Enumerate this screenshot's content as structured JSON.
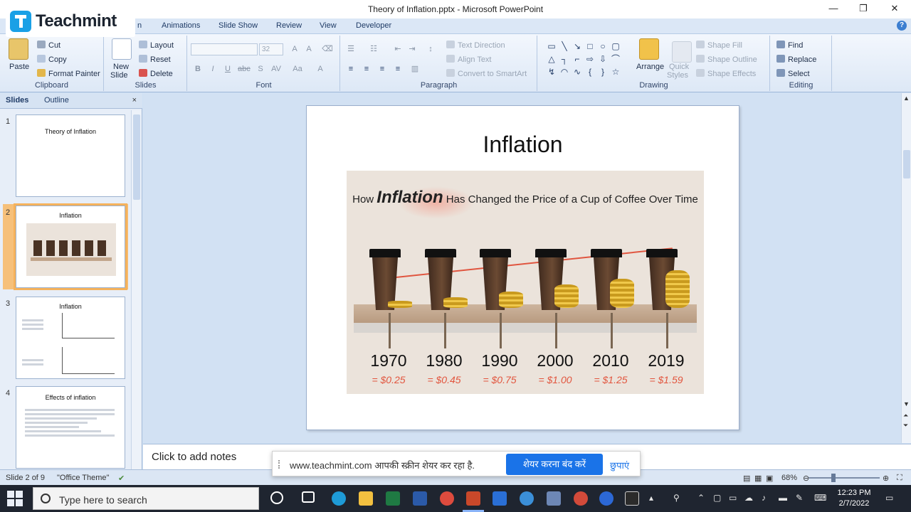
{
  "window": {
    "title": "Theory of Inflation.pptx - Microsoft PowerPoint",
    "minimize": "—",
    "restore": "❐",
    "close": "✕"
  },
  "overlay_logo": {
    "text": "Teachmint"
  },
  "tabs": [
    {
      "label": "n"
    },
    {
      "label": "Animations"
    },
    {
      "label": "Slide Show"
    },
    {
      "label": "Review"
    },
    {
      "label": "View"
    },
    {
      "label": "Developer"
    }
  ],
  "ribbon": {
    "clipboard": {
      "label": "Clipboard",
      "paste": "Paste",
      "cut": "Cut",
      "copy": "Copy",
      "format_painter": "Format Painter"
    },
    "slides": {
      "label": "Slides",
      "new_slide_1": "New",
      "new_slide_2": "Slide",
      "layout": "Layout",
      "reset": "Reset",
      "delete": "Delete"
    },
    "font": {
      "label": "Font",
      "size": "32"
    },
    "paragraph": {
      "label": "Paragraph",
      "text_direction": "Text Direction",
      "align_text": "Align Text",
      "convert_smartart": "Convert to SmartArt"
    },
    "drawing": {
      "label": "Drawing",
      "arrange": "Arrange",
      "quick_styles_1": "Quick",
      "quick_styles_2": "Styles",
      "shape_fill": "Shape Fill",
      "shape_outline": "Shape Outline",
      "shape_effects": "Shape Effects"
    },
    "editing": {
      "label": "Editing",
      "find": "Find",
      "replace": "Replace",
      "select": "Select"
    }
  },
  "left_pane": {
    "tab_slides": "Slides",
    "tab_outline": "Outline",
    "close": "×",
    "thumbnails": [
      {
        "num": "1",
        "title": "Theory of Inflation"
      },
      {
        "num": "2",
        "title": "Inflation"
      },
      {
        "num": "3",
        "title": "Inflation"
      },
      {
        "num": "4",
        "title": "Effects of inflation"
      }
    ]
  },
  "slide": {
    "title": "Inflation",
    "infographic": {
      "title_pre": "How ",
      "title_big": "Inflation",
      "title_post": " Has Changed the Price of a Cup of Coffee Over Time",
      "years": [
        "1970",
        "1980",
        "1990",
        "2000",
        "2010",
        "2019"
      ],
      "prices": [
        "= $0.25",
        "= $0.45",
        "= $0.75",
        "= $1.00",
        "= $1.25",
        "= $1.59"
      ]
    }
  },
  "notes": {
    "placeholder": "Click to add notes"
  },
  "share_banner": {
    "message": "www.teachmint.com आपकी स्क्रीन शेयर कर रहा है.",
    "stop": "शेयर करना बंद करें",
    "hide": "छुपाएं"
  },
  "status": {
    "slide_info": "Slide 2 of 9",
    "theme": "\"Office Theme\"",
    "zoom": "68%"
  },
  "taskbar": {
    "search_placeholder": "Type here to search",
    "time": "12:23 PM",
    "date": "2/7/2022"
  }
}
